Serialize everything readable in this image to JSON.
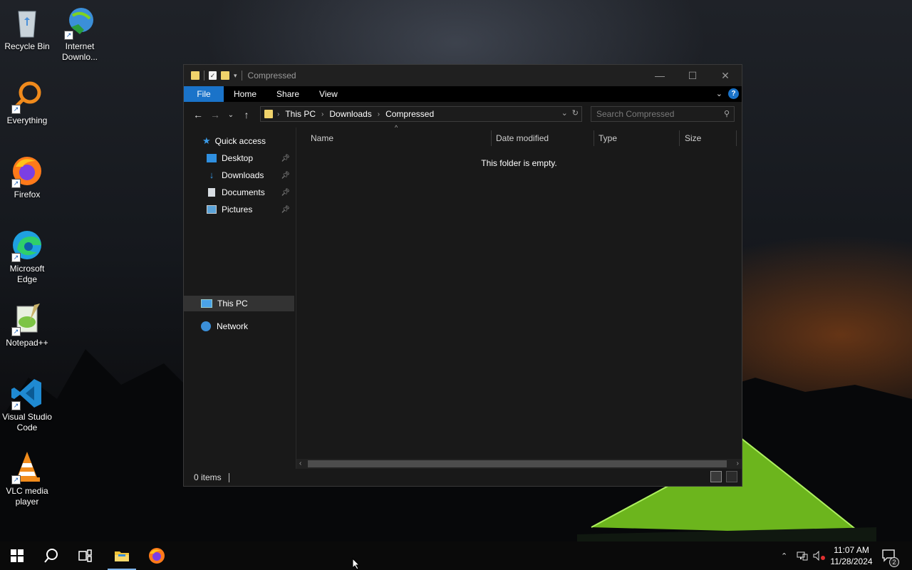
{
  "desktop": {
    "icons": [
      {
        "label": "Recycle Bin"
      },
      {
        "label": "Internet Downlo..."
      },
      {
        "label": "Everything"
      },
      {
        "label": "Firefox"
      },
      {
        "label": "Microsoft Edge"
      },
      {
        "label": "Notepad++"
      },
      {
        "label": "Visual Studio Code"
      },
      {
        "label": "VLC media player"
      }
    ]
  },
  "window": {
    "title": "Compressed",
    "controls": {
      "minimize": "—",
      "maximize": "☐",
      "close": "✕"
    },
    "ribbon": {
      "tabs": [
        "File",
        "Home",
        "Share",
        "View"
      ],
      "help": "?"
    },
    "address": {
      "crumbs": [
        "This PC",
        "Downloads",
        "Compressed"
      ]
    },
    "search": {
      "placeholder": "Search Compressed"
    },
    "nav": {
      "quick_access": "Quick access",
      "items": [
        {
          "label": "Desktop",
          "pinned": true
        },
        {
          "label": "Downloads",
          "pinned": true
        },
        {
          "label": "Documents",
          "pinned": true
        },
        {
          "label": "Pictures",
          "pinned": true
        }
      ],
      "this_pc": "This PC",
      "network": "Network"
    },
    "columns": [
      "Name",
      "Date modified",
      "Type",
      "Size"
    ],
    "empty_message": "This folder is empty.",
    "status": {
      "items_count": "0 items"
    }
  },
  "taskbar": {
    "apps": [
      "start-icon",
      "search-icon",
      "task-view-icon",
      "file-explorer-icon",
      "firefox-icon"
    ],
    "clock": {
      "time": "11:07 AM",
      "date": "11/28/2024"
    },
    "notifications": "2"
  },
  "colors": {
    "accent": "#1a73c9",
    "folder": "#f0d36b",
    "window_bg": "#191919"
  }
}
